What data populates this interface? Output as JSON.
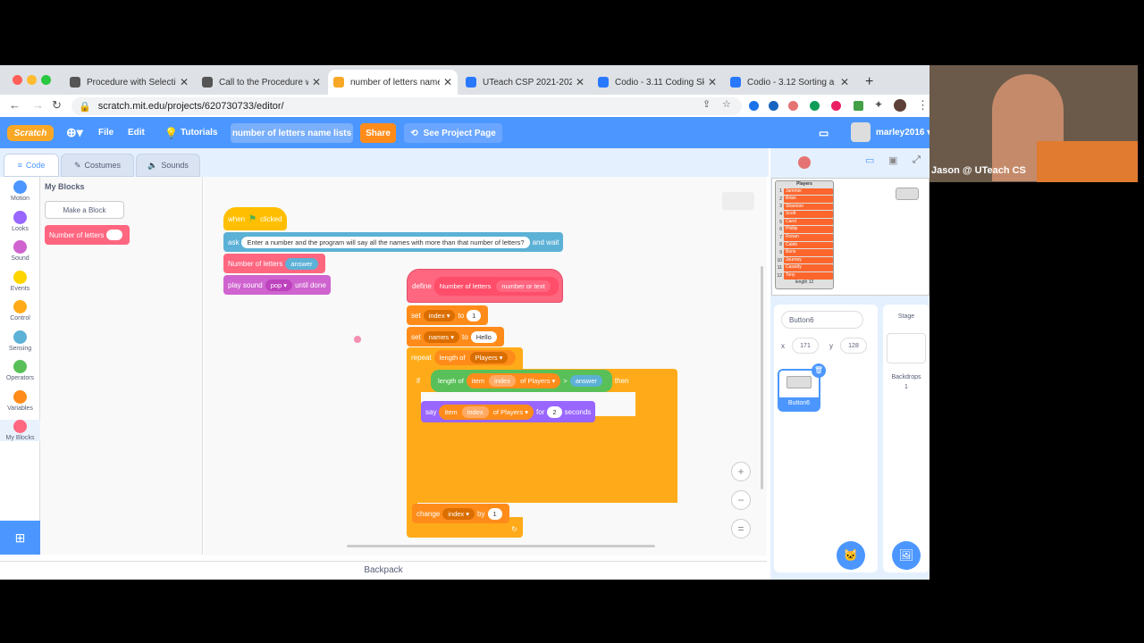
{
  "browser": {
    "tabs": [
      {
        "label": "Procedure with Selectio",
        "active": false
      },
      {
        "label": "Call to the Procedure wi",
        "active": false
      },
      {
        "label": "number of letters name",
        "active": true
      },
      {
        "label": "UTeach CSP 2021-2022",
        "active": false
      },
      {
        "label": "Codio - 3.11 Coding Skil",
        "active": false
      },
      {
        "label": "Codio - 3.12 Sorting a Li",
        "active": false
      }
    ],
    "url": "scratch.mit.edu/projects/620730733/editor/"
  },
  "menu": {
    "logo": "Scratch",
    "file": "File",
    "edit": "Edit",
    "tutorials": "Tutorials",
    "project_title": "number of letters name lists",
    "share": "Share",
    "see_project_page": "See Project Page",
    "username": "marley2016"
  },
  "editor_tabs": {
    "code": "Code",
    "costumes": "Costumes",
    "sounds": "Sounds"
  },
  "categories": [
    {
      "label": "Motion",
      "color": "#4c97ff"
    },
    {
      "label": "Looks",
      "color": "#9966ff"
    },
    {
      "label": "Sound",
      "color": "#cf63cf"
    },
    {
      "label": "Events",
      "color": "#ffd500"
    },
    {
      "label": "Control",
      "color": "#ffab19"
    },
    {
      "label": "Sensing",
      "color": "#5cb1d6"
    },
    {
      "label": "Operators",
      "color": "#59c059"
    },
    {
      "label": "Variables",
      "color": "#ff8c1a"
    },
    {
      "label": "My Blocks",
      "color": "#ff6680"
    }
  ],
  "palette": {
    "heading": "My Blocks",
    "make_block": "Make a Block",
    "custom_block": "Number of letters"
  },
  "script1": {
    "hat_when": "when",
    "hat_clicked": "clicked",
    "ask": "ask",
    "ask_text": "Enter a number and the program will say all the names with more than that number of letters?",
    "and_wait": "and wait",
    "call_block": "Number of letters",
    "call_arg": "answer",
    "play_sound": "play sound",
    "sound_name": "pop",
    "until_done": "until done"
  },
  "script2": {
    "define": "define",
    "define_name": "Number of letters",
    "define_param": "number or text",
    "set1": "set",
    "set1_var": "index",
    "to1": "to",
    "set1_val": "1",
    "set2": "set",
    "set2_var": "names",
    "to2": "to",
    "set2_val": "Hello",
    "repeat": "repeat",
    "length_of": "length of",
    "players1": "Players",
    "if": "if",
    "if_length_of": "length of",
    "item": "item",
    "index": "index",
    "of": "of",
    "players2": "Players",
    "gt": ">",
    "answer": "answer",
    "then": "then",
    "say": "say",
    "say_item": "item",
    "say_index": "index",
    "say_of": "of",
    "players3": "Players",
    "for": "for",
    "seconds_val": "2",
    "seconds": "seconds",
    "change": "change",
    "change_var": "index",
    "by": "by",
    "change_val": "1"
  },
  "backpack": "Backpack",
  "stage_list": {
    "title": "Players",
    "items": [
      "Jammer",
      "Brian",
      "Shannon",
      "Scott",
      "Carol",
      "Phillip",
      "Ronan",
      "Caleb",
      "Boris",
      "Journey",
      "Cassidy",
      "Tony"
    ],
    "footer": "length 12"
  },
  "sprite_info": {
    "name": "Button6",
    "x_label": "x",
    "x": "171",
    "y_label": "y",
    "y": "128",
    "thumb_label": "Button6"
  },
  "stage_pane": {
    "title": "Stage",
    "backdrops": "Backdrops",
    "count": "1"
  },
  "webcam": {
    "caption": "Jason @ UTeach CS"
  }
}
